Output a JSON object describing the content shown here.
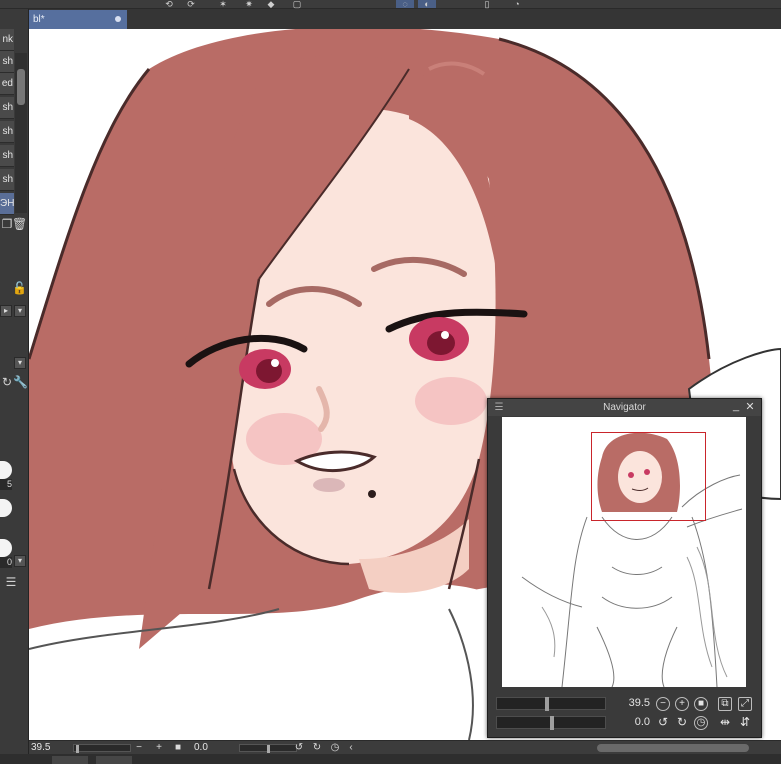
{
  "tab": {
    "title": "bl*"
  },
  "left_panel": {
    "brushes": [
      {
        "label": "nk"
      },
      {
        "label": "sh"
      },
      {
        "label": "ed"
      },
      {
        "label": "sh"
      },
      {
        "label": "sh"
      },
      {
        "label": "sh"
      },
      {
        "label": "sh"
      },
      {
        "label": "ЭН"
      }
    ],
    "size_labels": [
      "5",
      "0"
    ]
  },
  "navigator": {
    "title": "Navigator",
    "zoom_value": "39.5",
    "rotation_value": "0.0",
    "zoom_slider_level": 0.45,
    "rotation_slider_level": 0.5
  },
  "status_bar": {
    "zoom_value": "39.5",
    "angle_value": "0.0"
  },
  "colors": {
    "hair": "#b96c66",
    "skin": "#fbe4dc",
    "tab_active": "#566f9e",
    "selection_frame": "#c9252b"
  },
  "icons": {
    "trash": "trash-icon",
    "lock": "lock-icon",
    "zoom_out": "zoom-out-icon",
    "zoom_in": "zoom-in-icon",
    "rotate_left": "rotate-left-icon",
    "rotate_right": "rotate-right-icon",
    "flip_horizontal": "flip-horizontal-icon",
    "flip_vertical": "flip-vertical-icon"
  }
}
